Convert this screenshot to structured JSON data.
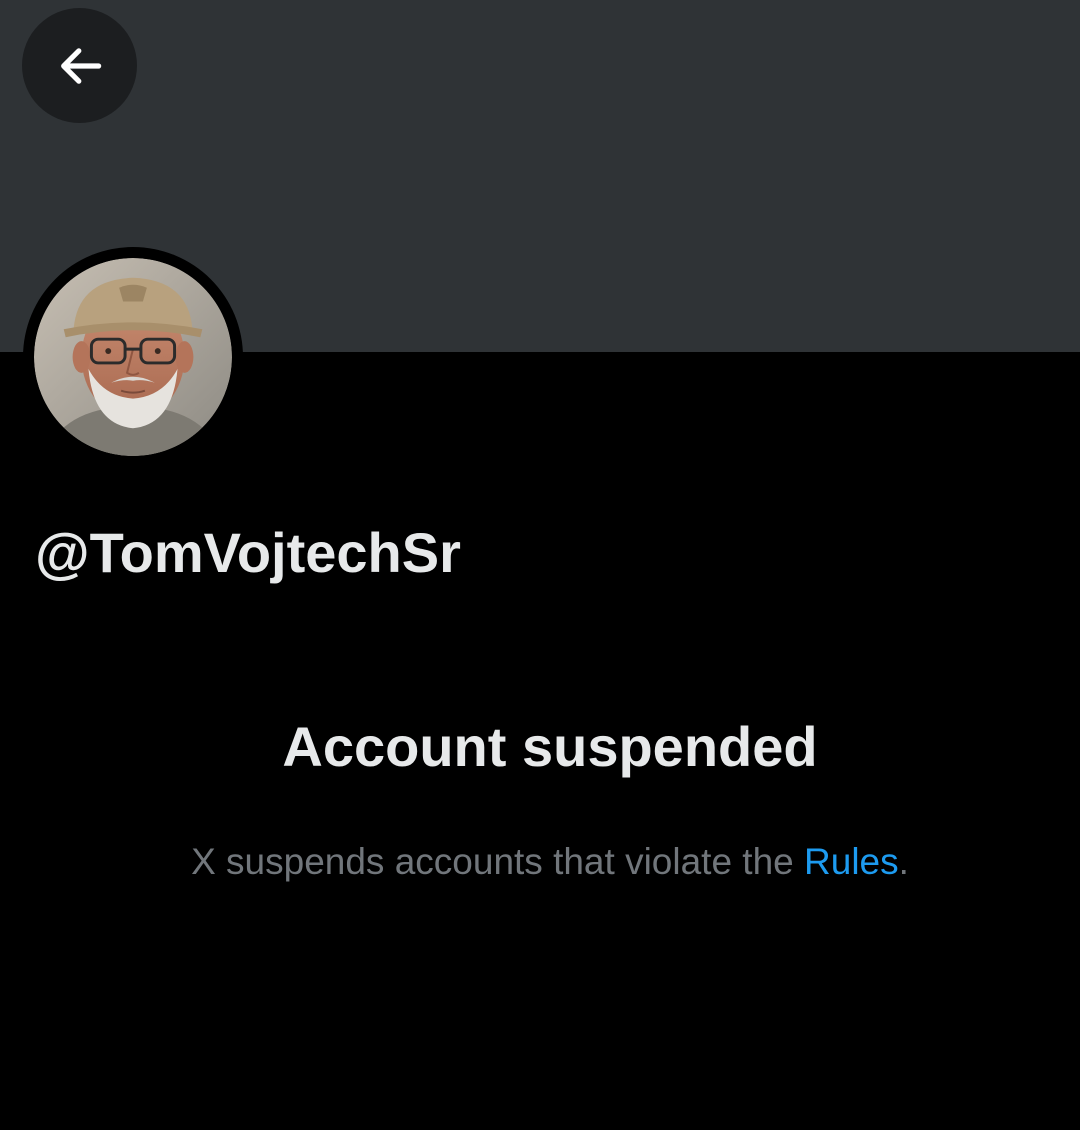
{
  "colors": {
    "page_background": "#000000",
    "banner_background": "#2f3336",
    "back_button_background": "#1c1e20",
    "primary_text": "#e7e9ea",
    "secondary_text": "#71767b",
    "link": "#1d9bf0"
  },
  "header": {
    "back_icon": "arrow-left-icon"
  },
  "profile": {
    "avatar_icon": "profile-photo",
    "handle": "@TomVojtechSr"
  },
  "notice": {
    "title": "Account suspended",
    "message_prefix": "X suspends accounts that violate the ",
    "rules_link": "Rules",
    "message_suffix": "."
  }
}
